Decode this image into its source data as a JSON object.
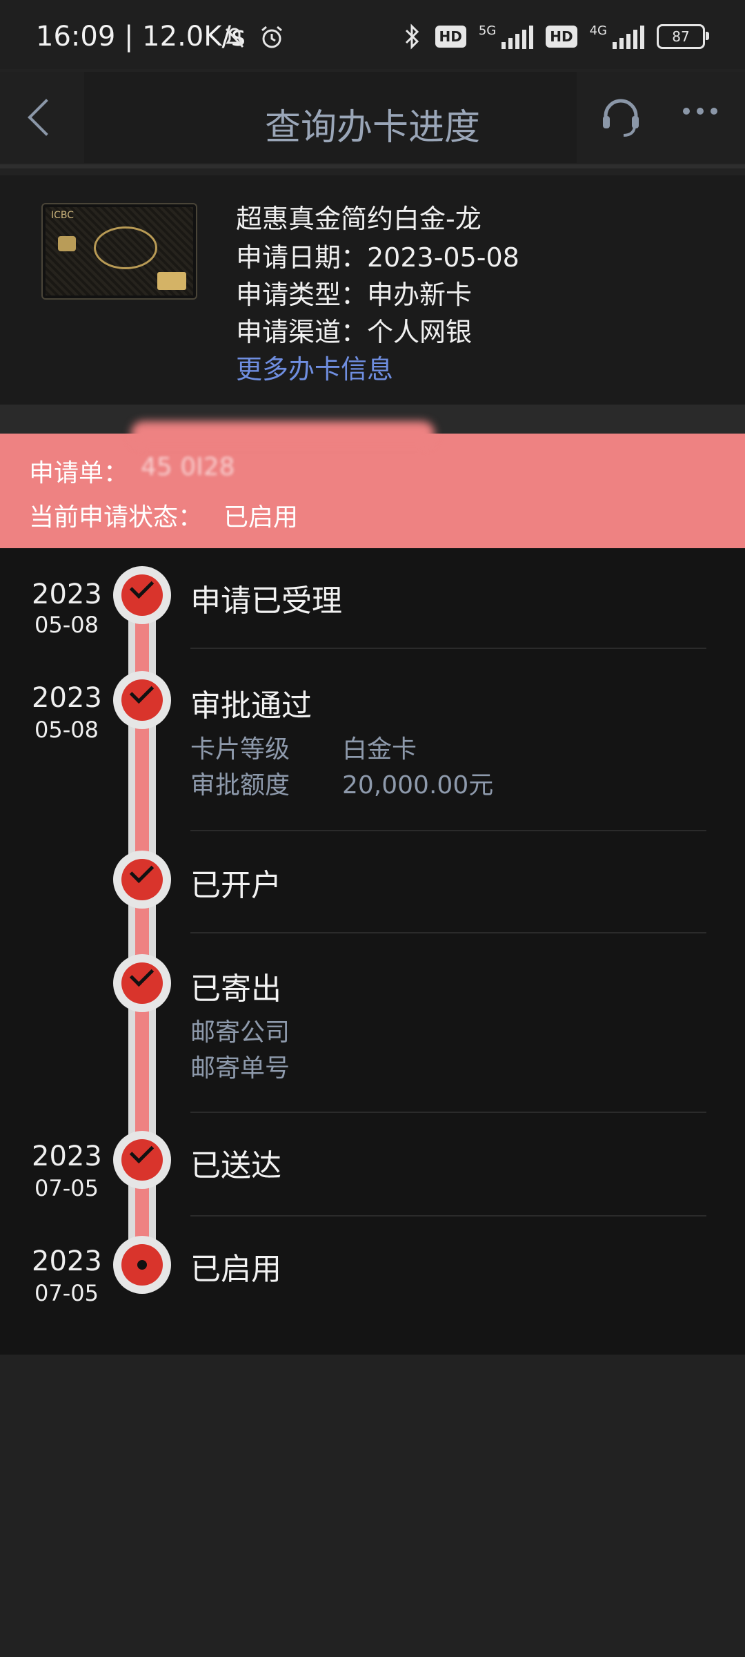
{
  "status_bar": {
    "time": "16:09 | 12.0K/s",
    "network_speed_icon": "mute-icon",
    "alarm_icon": "alarm-icon",
    "bluetooth_icon": "bluetooth-icon",
    "hd1": "HD",
    "net1": "5G",
    "hd2": "HD",
    "net2": "4G",
    "battery": "87"
  },
  "nav": {
    "title": "查询办卡进度"
  },
  "card": {
    "name": "超惠真金简约白金-龙",
    "date": "申请日期：2023-05-08",
    "type": "申请类型：申办新卡",
    "channel": "申请渠道：个人网银",
    "more_link": "更多办卡信息",
    "bank_mark": "ICBC"
  },
  "application": {
    "number_label": "申请单：",
    "number_value": "45      0I28",
    "state_label": "当前申请状态：",
    "state_value": "已启用"
  },
  "timeline": [
    {
      "year": "2023",
      "md": "05-08",
      "title": "申请已受理"
    },
    {
      "year": "2023",
      "md": "05-08",
      "title": "审批通过",
      "details": [
        {
          "label": "卡片等级",
          "value": "白金卡"
        },
        {
          "label": "审批额度",
          "value": "20,000.00元"
        }
      ]
    },
    {
      "year": "",
      "md": "",
      "title": "已开户"
    },
    {
      "year": "",
      "md": "",
      "title": "已寄出",
      "details": [
        {
          "label": "邮寄公司",
          "value": ""
        },
        {
          "label": "邮寄单号",
          "value": ""
        }
      ]
    },
    {
      "year": "2023",
      "md": "07-05",
      "title": "已送达"
    },
    {
      "year": "2023",
      "md": "07-05",
      "title": "已启用"
    }
  ],
  "colors": {
    "accent_pink": "#ee8282",
    "node_red": "#d9342c",
    "link_blue": "#6f8ee0"
  }
}
